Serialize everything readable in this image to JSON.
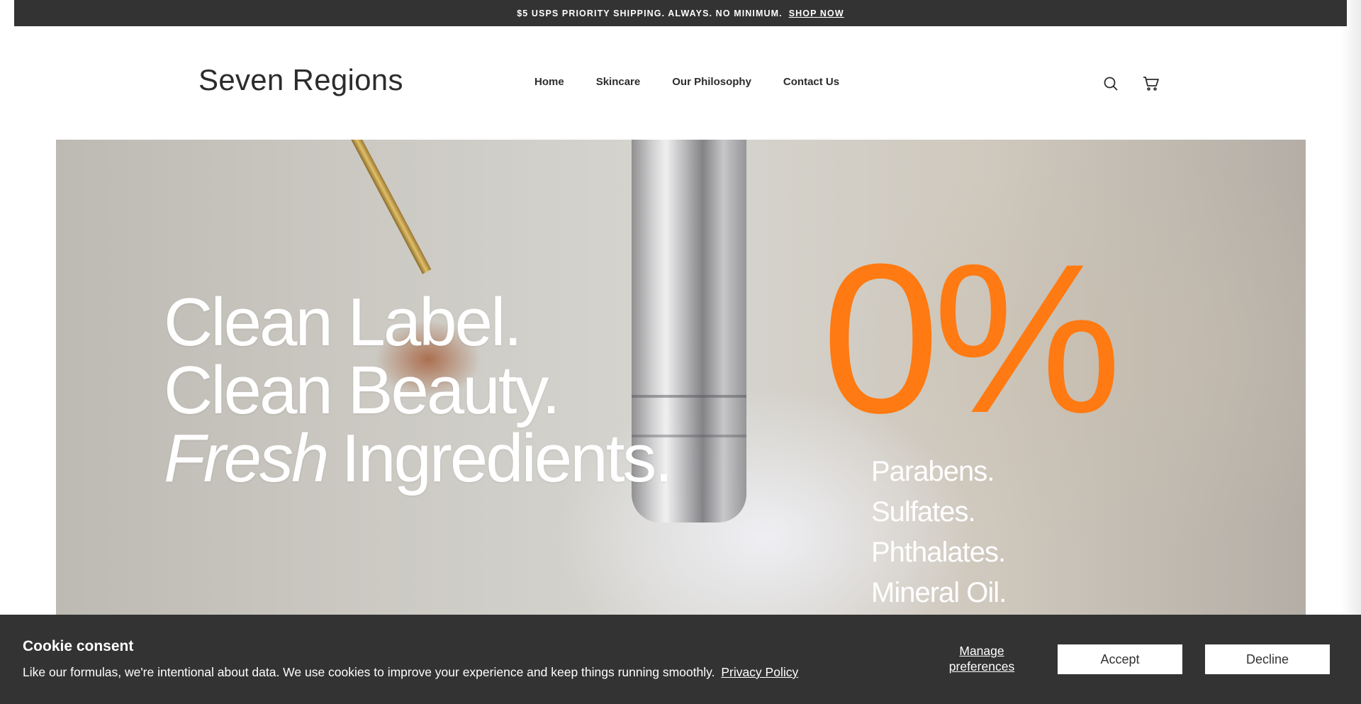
{
  "announcement": {
    "text": "$5 USPS PRIORITY SHIPPING. ALWAYS. NO MINIMUM.",
    "link": "SHOP NOW"
  },
  "header": {
    "logo": "Seven Regions",
    "nav": [
      {
        "label": "Home"
      },
      {
        "label": "Skincare"
      },
      {
        "label": "Our Philosophy"
      },
      {
        "label": "Contact Us"
      }
    ],
    "icons": [
      "search-icon",
      "cart-icon"
    ]
  },
  "hero": {
    "line1": "Clean Label.",
    "line2": "Clean Beauty.",
    "line3_italic": "Fresh",
    "line3_rest": "Ingredients.",
    "big_stat": "0%",
    "free_of": [
      "Parabens.",
      "Sulfates.",
      "Phthalates.",
      "Mineral Oil."
    ],
    "accent_color": "#ff7a12"
  },
  "cookie": {
    "title": "Cookie consent",
    "text": "Like our formulas, we're intentional about data. We use cookies to improve your experience and keep things running smoothly.",
    "policy_link": "Privacy Policy",
    "manage": "Manage preferences",
    "accept": "Accept",
    "decline": "Decline"
  }
}
